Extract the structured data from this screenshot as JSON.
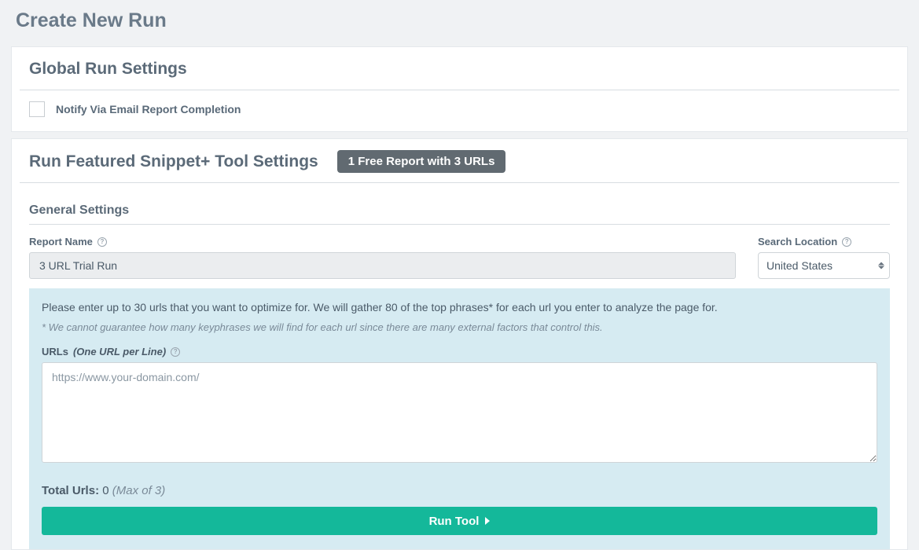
{
  "page": {
    "title": "Create New Run"
  },
  "global_settings": {
    "header": "Global Run Settings",
    "notify_label": "Notify Via Email Report Completion"
  },
  "tool_settings": {
    "header": "Run Featured Snippet+ Tool Settings",
    "badge": "1 Free Report with 3 URLs"
  },
  "general": {
    "header": "General Settings",
    "report_name_label": "Report Name",
    "report_name_value": "3 URL Trial Run",
    "search_location_label": "Search Location",
    "search_location_value": "United States"
  },
  "urls_section": {
    "info_text": "Please enter up to 30 urls that you want to optimize for. We will gather 80 of the top phrases* for each url you enter to analyze the page for.",
    "info_note": "* We cannot guarantee how many keyphrases we will find for each url since there are many external factors that control this.",
    "urls_label": "URLs",
    "urls_perline": "(One URL per Line)",
    "urls_placeholder": "https://www.your-domain.com/",
    "total_label": "Total Urls:",
    "total_count": "0",
    "total_max": "(Max of 3)",
    "run_button": "Run Tool"
  }
}
